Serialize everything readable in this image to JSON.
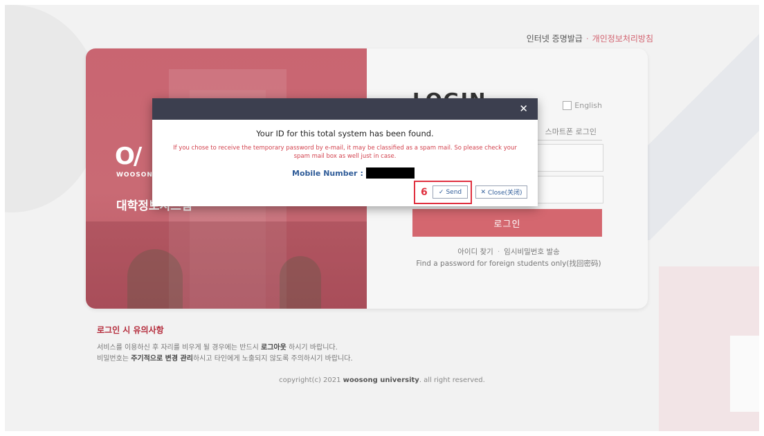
{
  "header": {
    "cert_link": "인터넷 증명발급",
    "separator": "·",
    "privacy_link": "개인정보처리방침"
  },
  "login": {
    "title": "LOGIN",
    "english_label": "English",
    "smart_login": "스마트폰 로그인",
    "login_button": "로그인",
    "find_id": "아이디 찾기",
    "temp_password": "임시비밀번호 발송",
    "separator": "·",
    "foreign_find": "Find a password for foreign students only(找回密码)"
  },
  "brand": {
    "logo_mark": "O/",
    "logo_text": "WOOSONG",
    "title": "대학정보시스템"
  },
  "notice": {
    "heading": "로그인 시 유의사항",
    "line1_pre": "서비스를 이용하신 후 자리를 비우게 될 경우에는 반드시 ",
    "line1_bold": "로그아웃",
    "line1_post": " 하시기 바랍니다.",
    "line2_pre": "비밀번호는 ",
    "line2_bold": "주기적으로 변경 관리",
    "line2_post": "하시고 타인에게 노출되지 않도록 주의하시기 바랍니다."
  },
  "footer": {
    "pre": "copyright(c) 2021 ",
    "bold": "woosong university",
    "post": ". all right reserved."
  },
  "modal": {
    "close_glyph": "✕",
    "title": "Your ID for this total system has been found.",
    "warning": "If you chose to receive the temporary password by e-mail, it may be classified as a spam mail. So please check your spam mail box as well just in case.",
    "mobile_label": "Mobile Number",
    "mobile_colon": ":",
    "step_number": "6",
    "send_icon": "✓",
    "send_label": "Send",
    "close_icon": "✕",
    "close_label": "Close(关闭)"
  },
  "colors": {
    "accent": "#d4676f",
    "modal_header": "#3c3f4f",
    "warning_text": "#d2414d",
    "link_blue": "#2e5b98",
    "highlight_red": "#e0303f"
  }
}
